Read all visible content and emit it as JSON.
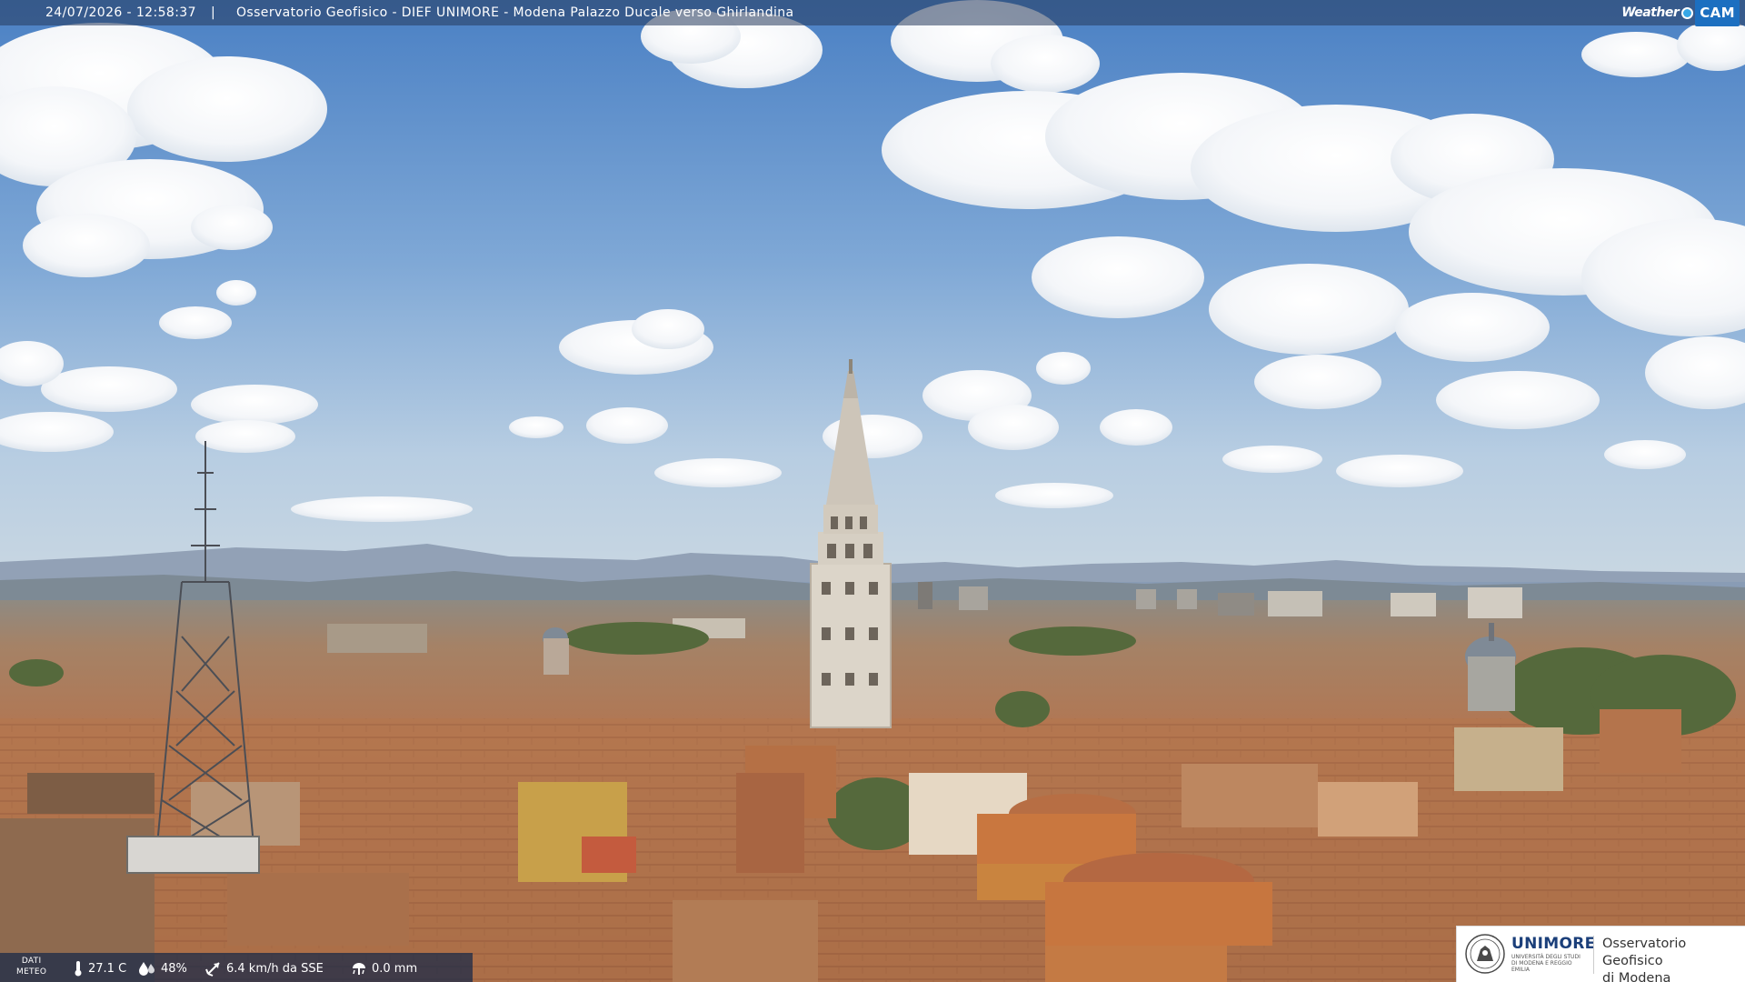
{
  "overlay": {
    "timestamp": "24/07/2026 - 12:58:37",
    "separator": "|",
    "camera_title": "Osservatorio Geofisico - DIEF UNIMORE - Modena Palazzo Ducale verso Ghirlandina",
    "brand": {
      "weather": "Weather",
      "cam": "CAM"
    }
  },
  "meteo": {
    "label_line1": "DATI",
    "label_line2": "METEO",
    "temperature": "27.1 C",
    "humidity": "48%",
    "wind": "6.4 km/h da SSE",
    "rain": "0.0 mm"
  },
  "logo": {
    "uni_strong": "UNI",
    "uni_rest": "MORE",
    "uni_subtitle": "UNIVERSITÀ DEGLI STUDI DI MODENA E REGGIO EMILIA",
    "observatory_line1": "Osservatorio Geofisico",
    "observatory_line2": "di Modena"
  },
  "icons": {
    "temperature": "thermometer-icon",
    "humidity": "droplets-icon",
    "wind": "wind-vane-icon",
    "rain": "rain-gauge-icon",
    "brand": "weathercam-dot-icon",
    "seal": "unimore-seal-icon"
  },
  "colors": {
    "sky_top": "#4f86c8",
    "sky_horizon": "#b9cfe3",
    "roof": "#b5764c",
    "tower": "#d8d1c4",
    "brand_blue": "#1c6fc0",
    "logo_navy": "#1b3f7a"
  }
}
